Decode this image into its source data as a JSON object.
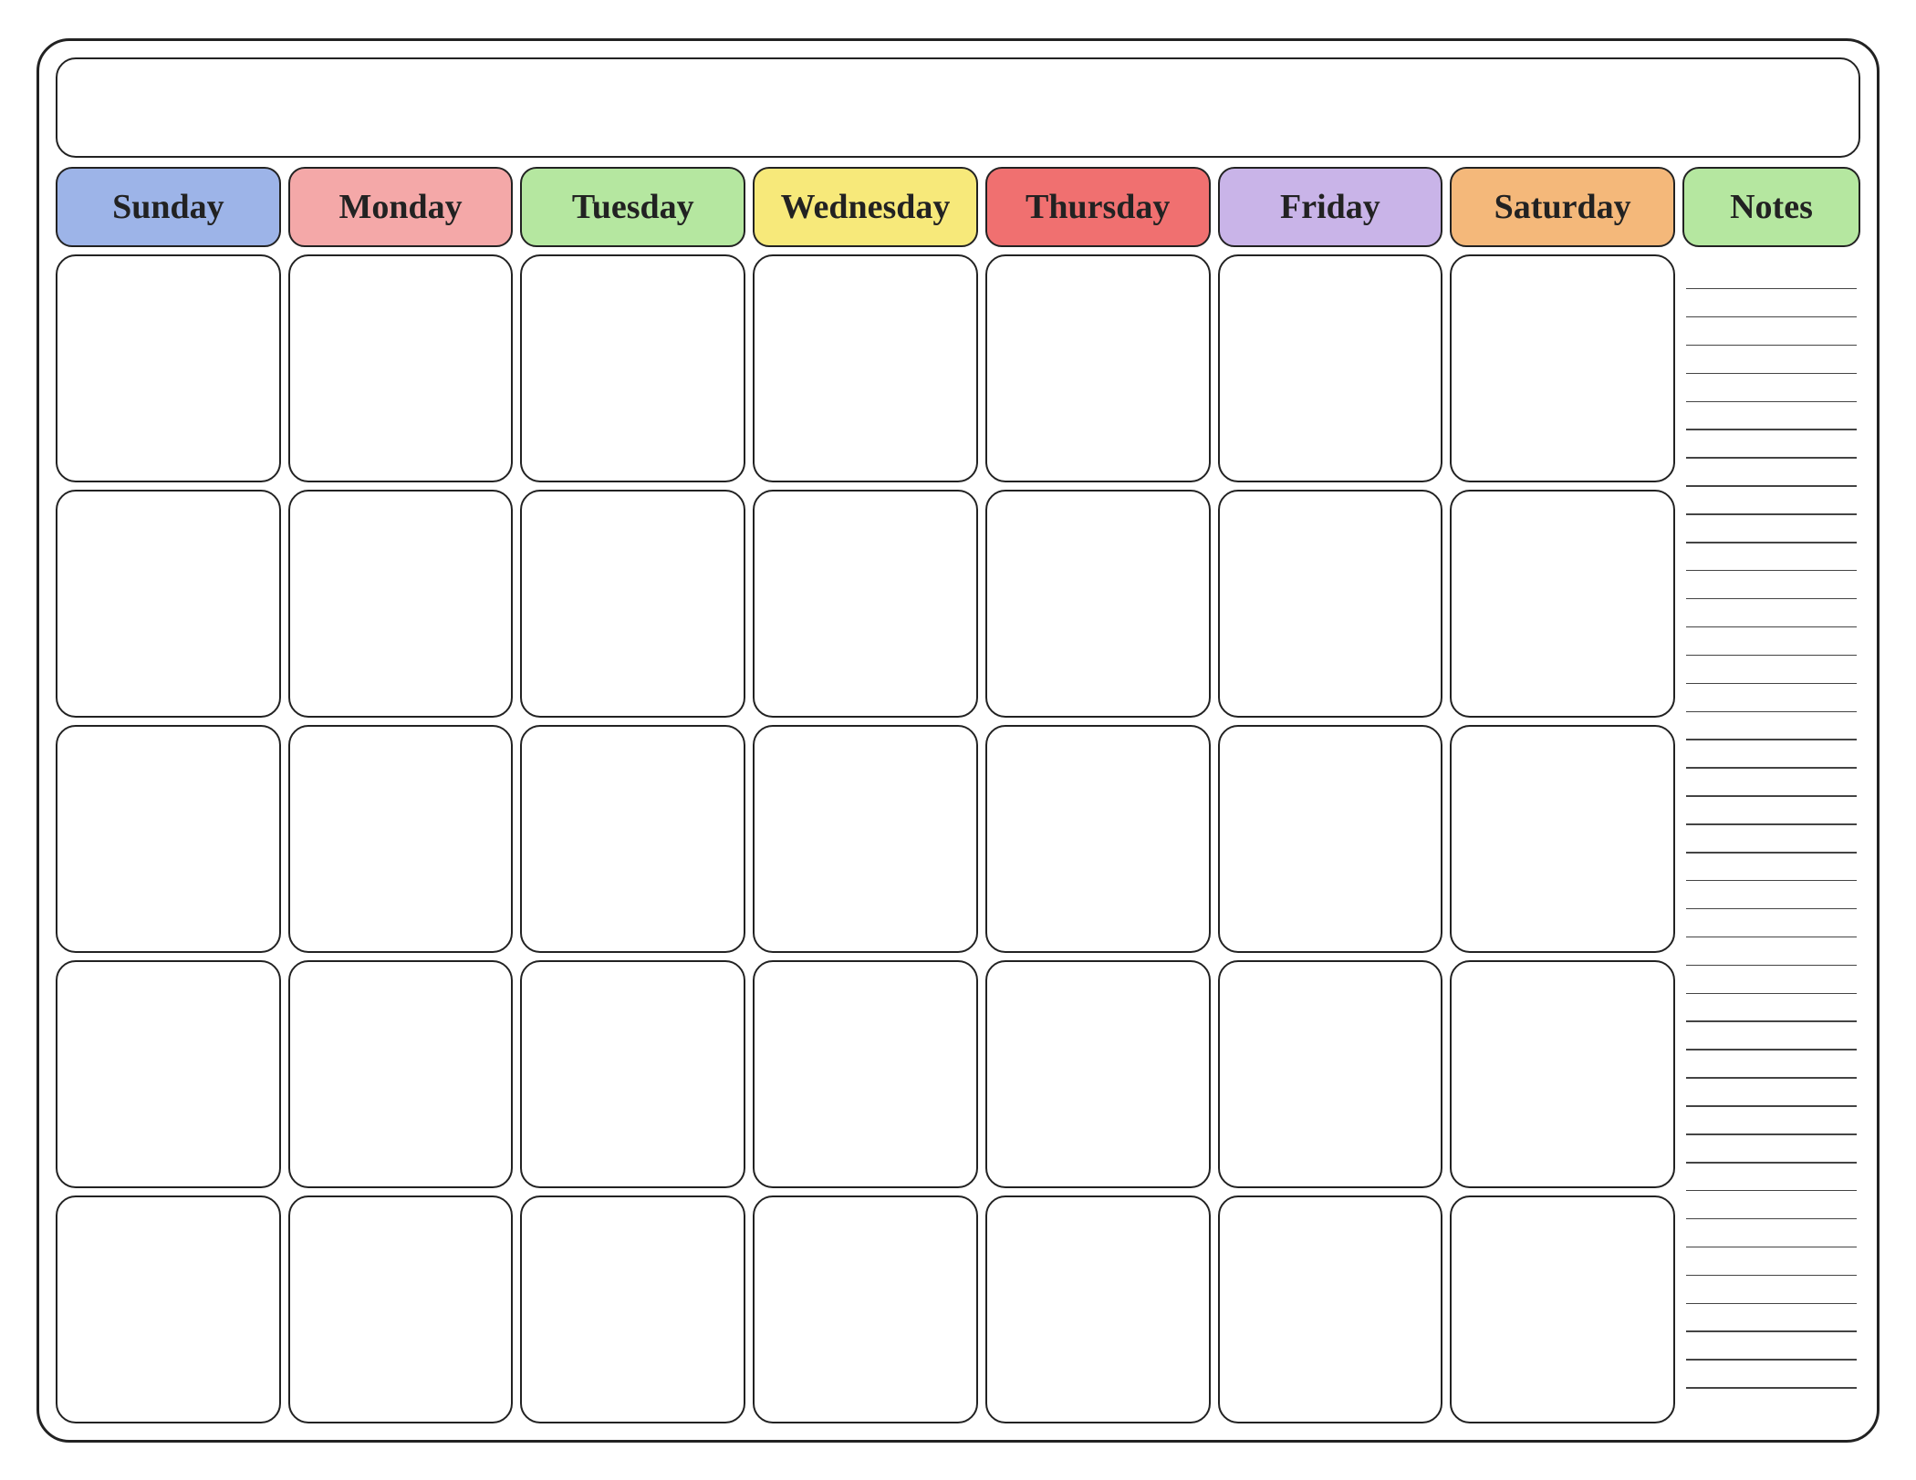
{
  "title": "",
  "days": [
    {
      "label": "Sunday",
      "class": "sunday"
    },
    {
      "label": "Monday",
      "class": "monday"
    },
    {
      "label": "Tuesday",
      "class": "tuesday"
    },
    {
      "label": "Wednesday",
      "class": "wednesday"
    },
    {
      "label": "Thursday",
      "class": "thursday"
    },
    {
      "label": "Friday",
      "class": "friday"
    },
    {
      "label": "Saturday",
      "class": "saturday"
    }
  ],
  "notes": {
    "label": "Notes",
    "line_count": 40
  },
  "rows": 5
}
